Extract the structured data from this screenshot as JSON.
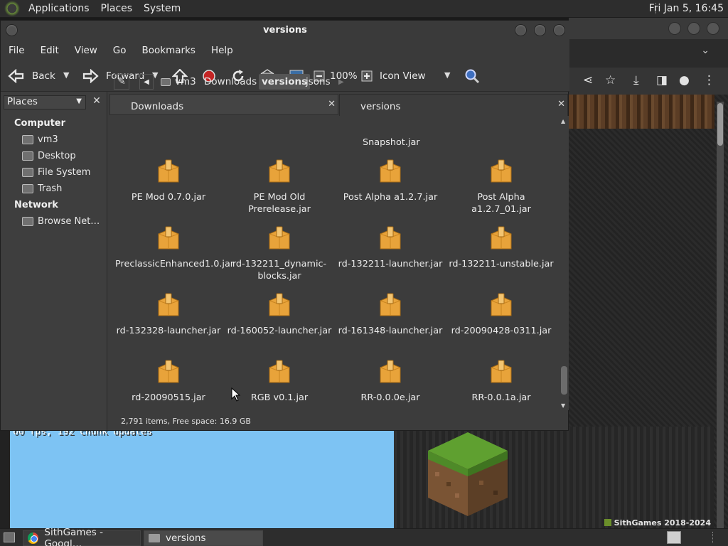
{
  "top_panel": {
    "menus": [
      "Applications",
      "Places",
      "System"
    ],
    "clock": "Fri Jan  5, 16:45"
  },
  "window": {
    "title": "versions",
    "menus": [
      "File",
      "Edit",
      "View",
      "Go",
      "Bookmarks",
      "Help"
    ]
  },
  "toolbar": {
    "back": "Back",
    "forward": "Forward",
    "zoom": "100%",
    "view_mode": "Icon View"
  },
  "sidebar": {
    "header": "Places",
    "computer_label": "Computer",
    "computer_items": [
      "vm3",
      "Desktop",
      "File System",
      "Trash"
    ],
    "network_label": "Network",
    "network_items": [
      "Browse Net…"
    ]
  },
  "location": {
    "crumbs": [
      "vm3",
      "Downloads",
      "versions",
      "jsons"
    ],
    "active": "versions"
  },
  "tabs": [
    "Downloads",
    "versions"
  ],
  "content": {
    "partial_top_label": "Snapshot.jar",
    "files": [
      "PE Mod 0.7.0.jar",
      "PE Mod Old Prerelease.jar",
      "Post Alpha a1.2.7.jar",
      "Post Alpha a1.2.7_01.jar",
      "PreclassicEnhanced1.0.jar",
      "rd-132211_dynamic-blocks.jar",
      "rd-132211-launcher.jar",
      "rd-132211-unstable.jar",
      "rd-132328-launcher.jar",
      "rd-160052-launcher.jar",
      "rd-161348-launcher.jar",
      "rd-20090428-0311.jar",
      "rd-20090515.jar",
      "RGB v0.1.jar",
      "RR-0.0.0e.jar",
      "RR-0.0.1a.jar"
    ]
  },
  "status": "2,791 items, Free space: 16.9 GB",
  "background": {
    "mc_debug_text": "60 fps, 192 chunk updates",
    "credit": "SithGames 2018-2024"
  },
  "taskbar": {
    "tasks": [
      "SithGames - Googl…",
      "versions"
    ]
  },
  "colors": {
    "folder_fill": "#e8a33a",
    "panel_bg": "#2d2d2d",
    "window_bg": "#3c3c3c",
    "sky": "#7dc3f3"
  }
}
